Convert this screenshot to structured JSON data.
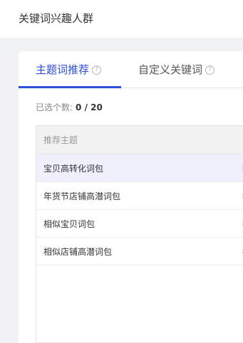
{
  "header": {
    "title": "关键词兴趣人群"
  },
  "tabs": [
    {
      "label": "主题词推荐",
      "active": true
    },
    {
      "label": "自定义关键词",
      "active": false
    }
  ],
  "help_glyph": "?",
  "selection": {
    "label": "已选个数:",
    "value": "0 / 20"
  },
  "list": {
    "header": "推荐主题",
    "items": [
      {
        "label": "宝贝高转化词包",
        "selected": true
      },
      {
        "label": "年货节店铺高潜词包",
        "selected": false
      },
      {
        "label": "相似宝贝词包",
        "selected": false
      },
      {
        "label": "相似店铺高潜词包",
        "selected": false
      }
    ],
    "chevron": "›"
  },
  "colors": {
    "accent": "#2d51d8",
    "selected_row": "#eef1fb",
    "background": "#f0f2f5"
  }
}
